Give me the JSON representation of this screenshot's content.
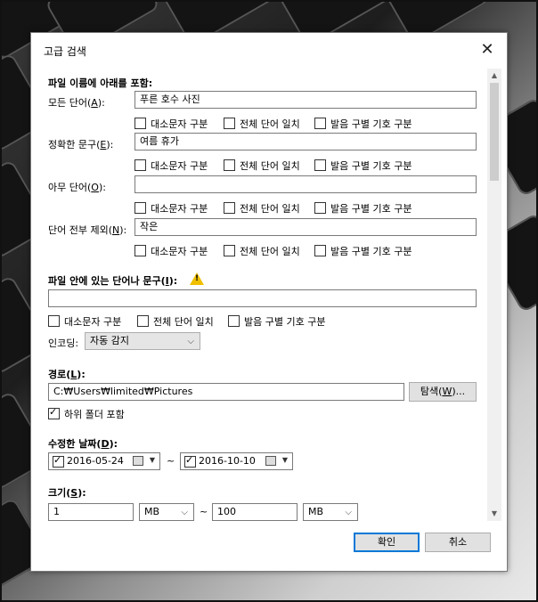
{
  "window": {
    "title": "고급 검색",
    "close_glyph": "✕"
  },
  "name_section": {
    "heading": "파일 이름에 아래를 포함:",
    "rows": [
      {
        "label": "모든 단어(A):",
        "value": "푸른 호수 사진"
      },
      {
        "label": "정확한 문구(E):",
        "value": "여름 휴가"
      },
      {
        "label": "아무 단어(O):",
        "value": ""
      },
      {
        "label": "단어 전부 제외(N):",
        "value": "작은"
      }
    ],
    "options": [
      "대소문자 구분",
      "전체 단어 일치",
      "발음 구별 기호 구분"
    ]
  },
  "content_section": {
    "heading": "파일 안에 있는 단어나 문구(I):",
    "value": "",
    "options": [
      "대소문자 구분",
      "전체 단어 일치",
      "발음 구별 기호 구분"
    ],
    "encoding_label": "인코딩:",
    "encoding_value": "자동 감지"
  },
  "path_section": {
    "heading": "경로(L):",
    "value": "C:₩Users₩limited₩Pictures",
    "browse_label": "탐색(W)...",
    "subfolders_label": "하위 폴더 포함",
    "subfolders_checked": true
  },
  "date_section": {
    "heading": "수정한 날짜(D):",
    "from": "2016-05-24",
    "to": "2016-10-10",
    "separator": "~"
  },
  "size_section": {
    "heading": "크기(S):",
    "min": "1",
    "min_unit": "MB",
    "max": "100",
    "max_unit": "MB",
    "separator": "~"
  },
  "footer": {
    "ok_label": "확인",
    "cancel_label": "취소"
  },
  "colors": {
    "accent": "#0078d7",
    "warning": "#f0c000"
  }
}
